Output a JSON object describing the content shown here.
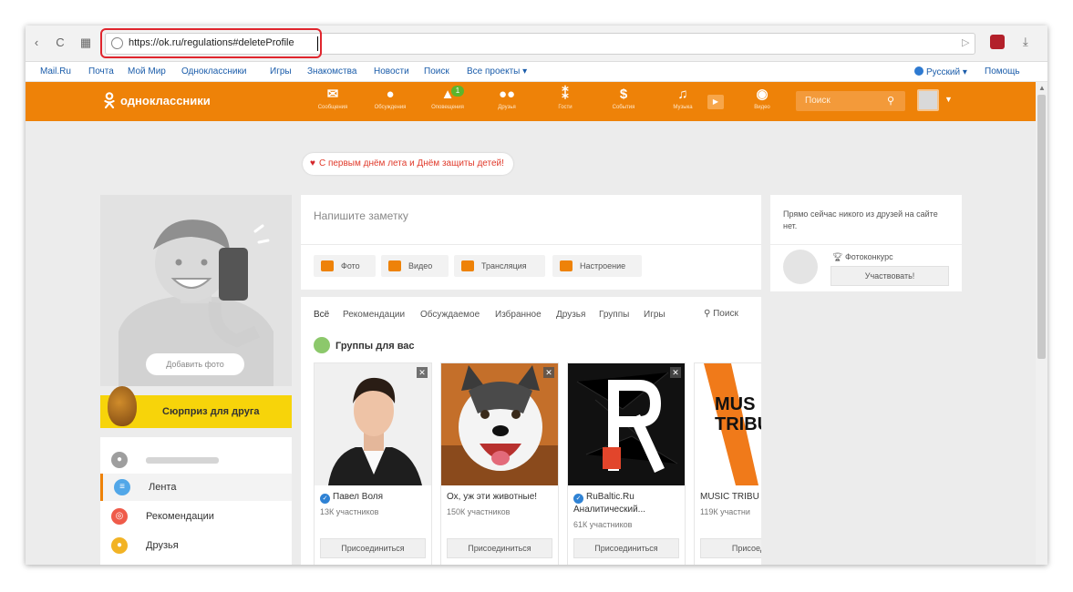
{
  "browser": {
    "url": "https://ok.ru/regulations#deleteProfile",
    "nav_back": "‹",
    "nav_reload": "C",
    "nav_grid": "▦"
  },
  "links_bar": {
    "items": [
      "Mail.Ru",
      "Почта",
      "Мой Мир",
      "Одноклассники",
      "Игры",
      "Знакомства",
      "Новости",
      "Поиск",
      "Все проекты ▾"
    ],
    "language": "Русский ▾",
    "help": "Помощь"
  },
  "ok_header": {
    "logo_text": "одноклассники",
    "nav": [
      {
        "label": "Сообщения",
        "icon": "envelope-icon"
      },
      {
        "label": "Обсуждения",
        "icon": "chat-icon"
      },
      {
        "label": "Оповещения",
        "icon": "bell-icon",
        "badge": "1"
      },
      {
        "label": "Друзья",
        "icon": "friends-icon"
      },
      {
        "label": "Гости",
        "icon": "footprints-icon"
      },
      {
        "label": "События",
        "icon": "events-icon"
      },
      {
        "label": "Музыка",
        "icon": "music-icon"
      },
      {
        "label": "Видео",
        "icon": "video-icon"
      }
    ],
    "search_placeholder": "Поиск"
  },
  "holiday_banner": "С первым днём лета и Днём защиты детей!",
  "profile": {
    "add_photo": "Добавить фото",
    "surprise": "Сюрприз для друга",
    "menu": [
      {
        "label": "",
        "color": "#9e9e9e"
      },
      {
        "label": "Лента",
        "color": "#52a7e8",
        "active": true
      },
      {
        "label": "Рекомендации",
        "color": "#ef5b4a"
      },
      {
        "label": "Друзья",
        "color": "#f2b325"
      }
    ]
  },
  "note": {
    "placeholder": "Напишите заметку",
    "actions": [
      "Фото",
      "Видео",
      "Трансляция",
      "Настроение"
    ]
  },
  "feed": {
    "tabs": [
      "Всё",
      "Рекомендации",
      "Обсуждаемое",
      "Избранное",
      "Друзья",
      "Группы",
      "Игры"
    ],
    "search": "Поиск",
    "groups_heading": "Группы для вас",
    "groups": [
      {
        "name": "Павел Воля",
        "count": "13К участников",
        "verified": true,
        "join": "Присоединиться"
      },
      {
        "name": "Ох, уж эти животные!",
        "count": "150К участников",
        "verified": false,
        "join": "Присоединиться"
      },
      {
        "name": "RuBaltic.Ru Аналитический...",
        "count": "61К участников",
        "verified": true,
        "join": "Присоединиться"
      },
      {
        "name": "MUSIC TRIBU",
        "count": "119К участни",
        "verified": false,
        "join": "Присоедин"
      }
    ],
    "music_tribe_lines": [
      "MUS",
      "TRIBU"
    ]
  },
  "friends_panel": {
    "text": "Прямо сейчас никого из друзей на сайте нет.",
    "contest": "Фотоконкурс",
    "participate": "Участвовать!"
  },
  "colors": {
    "ok_orange": "#ee8208",
    "url_highlight": "#e0262e",
    "surprise_yellow": "#f7d40a"
  }
}
